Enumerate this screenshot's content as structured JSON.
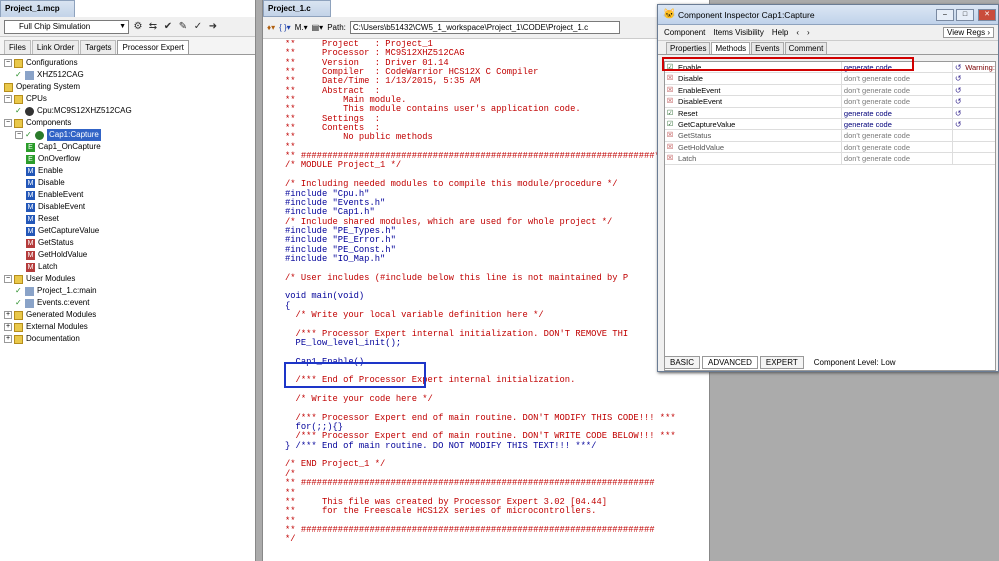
{
  "left": {
    "title": "Project_1.mcp",
    "target": "Full Chip Simulation",
    "tabs": [
      "Files",
      "Link Order",
      "Targets",
      "Processor Expert"
    ],
    "tree": {
      "configurations": "Configurations",
      "config_item": "XHZ512CAG",
      "operating_system": "Operating System",
      "cpus": "CPUs",
      "cpu_item": "Cpu:MC9S12XHZ512CAG",
      "components": "Components",
      "cap1": "Cap1:Capture",
      "methods": [
        "Cap1_OnCapture",
        "OnOverflow",
        "Enable",
        "Disable",
        "EnableEvent",
        "DisableEvent",
        "Reset",
        "GetCaptureValue",
        "GetStatus",
        "GetHoldValue",
        "Latch"
      ],
      "user_modules": "User Modules",
      "um_items": [
        "Project_1.c:main",
        "Events.c:event"
      ],
      "generated_modules": "Generated Modules",
      "external_modules": "External Modules",
      "documentation": "Documentation"
    }
  },
  "editor": {
    "title": "Project_1.c",
    "path_label": "Path:",
    "path": "C:\\Users\\b51432\\CW5_1_workspace\\Project_1\\CODE\\Project_1.c",
    "toolbar_glyphs": [
      "{ }",
      "M.",
      "Path:"
    ]
  },
  "code_lines": [
    "**     Project   : Project_1",
    "**     Processor : MC9S12XHZ512CAG",
    "**     Version   : Driver 01.14",
    "**     Compiler  : CodeWarrior HCS12X C Compiler",
    "**     Date/Time : 1/13/2015, 5:35 AM",
    "**     Abstract  :",
    "**         Main module.",
    "**         This module contains user's application code.",
    "**     Settings  :",
    "**     Contents  :",
    "**         No public methods",
    "**",
    "** ###################################################################*/",
    "/* MODULE Project_1 */",
    "",
    "/* Including needed modules to compile this module/procedure */",
    "#include \"Cpu.h\"",
    "#include \"Events.h\"",
    "#include \"Cap1.h\"",
    "/* Include shared modules, which are used for whole project */",
    "#include \"PE_Types.h\"",
    "#include \"PE_Error.h\"",
    "#include \"PE_Const.h\"",
    "#include \"IO_Map.h\"",
    "",
    "/* User includes (#include below this line is not maintained by P",
    "",
    "void main(void)",
    "{",
    "  /* Write your local variable definition here */",
    "",
    "  /*** Processor Expert internal initialization. DON'T REMOVE THI",
    "  PE_low_level_init();",
    "",
    "  Cap1_Enable()",
    "",
    "  /*** End of Processor Expert internal initialization.",
    "",
    "  /* Write your code here */",
    "",
    "  /*** Processor Expert end of main routine. DON'T MODIFY THIS CODE!!! ***",
    "  for(;;){}",
    "  /*** Processor Expert end of main routine. DON'T WRITE CODE BELOW!!! ***",
    "} /*** End of main routine. DO NOT MODIFY THIS TEXT!!! ***/",
    "",
    "/* END Project_1 */",
    "/*",
    "** ###################################################################",
    "**",
    "**     This file was created by Processor Expert 3.02 [04.44]",
    "**     for the Freescale HCS12X series of microcontrollers.",
    "**",
    "** ###################################################################",
    "*/"
  ],
  "code_colors": [
    "c",
    "c",
    "c",
    "c",
    "c",
    "c",
    "c",
    "c",
    "c",
    "c",
    "c",
    "c",
    "c",
    "c",
    "",
    "c",
    "k",
    "k",
    "k",
    "c",
    "k",
    "k",
    "k",
    "k",
    "",
    "c",
    "",
    "k",
    "k",
    "c",
    "",
    "c",
    "k",
    "",
    "k",
    "",
    "c",
    "",
    "c",
    "",
    "c",
    "k",
    "c",
    "k",
    "",
    "c",
    "c",
    "c",
    "c",
    "c",
    "c",
    "c",
    "c",
    "c"
  ],
  "inspector": {
    "title": "Component Inspector Cap1:Capture",
    "menu": [
      "Component",
      "Items Visibility",
      "Help",
      "‹",
      "›"
    ],
    "view_regs": "View Regs ›",
    "tabs": [
      "Properties",
      "Methods",
      "Events",
      "Comment"
    ],
    "rows": [
      {
        "name": "Enable",
        "value": "generate code",
        "on": true,
        "warn": "Warning:"
      },
      {
        "name": "Disable",
        "value": "don't generate code",
        "on": false,
        "warn": ""
      },
      {
        "name": "EnableEvent",
        "value": "don't generate code",
        "on": false,
        "warn": ""
      },
      {
        "name": "DisableEvent",
        "value": "don't generate code",
        "on": false,
        "warn": ""
      },
      {
        "name": "Reset",
        "value": "generate code",
        "on": true,
        "warn": ""
      },
      {
        "name": "GetCaptureValue",
        "value": "generate code",
        "on": true,
        "warn": ""
      },
      {
        "name": "GetStatus",
        "value": "don't generate code",
        "on": false,
        "warn": "",
        "gray": true
      },
      {
        "name": "GetHoldValue",
        "value": "don't generate code",
        "on": false,
        "warn": "",
        "gray": true
      },
      {
        "name": "Latch",
        "value": "don't generate code",
        "on": false,
        "warn": "",
        "gray": true
      }
    ],
    "footer_tabs": [
      "BASIC",
      "ADVANCED",
      "EXPERT"
    ],
    "component_level": "Component Level: Low"
  }
}
